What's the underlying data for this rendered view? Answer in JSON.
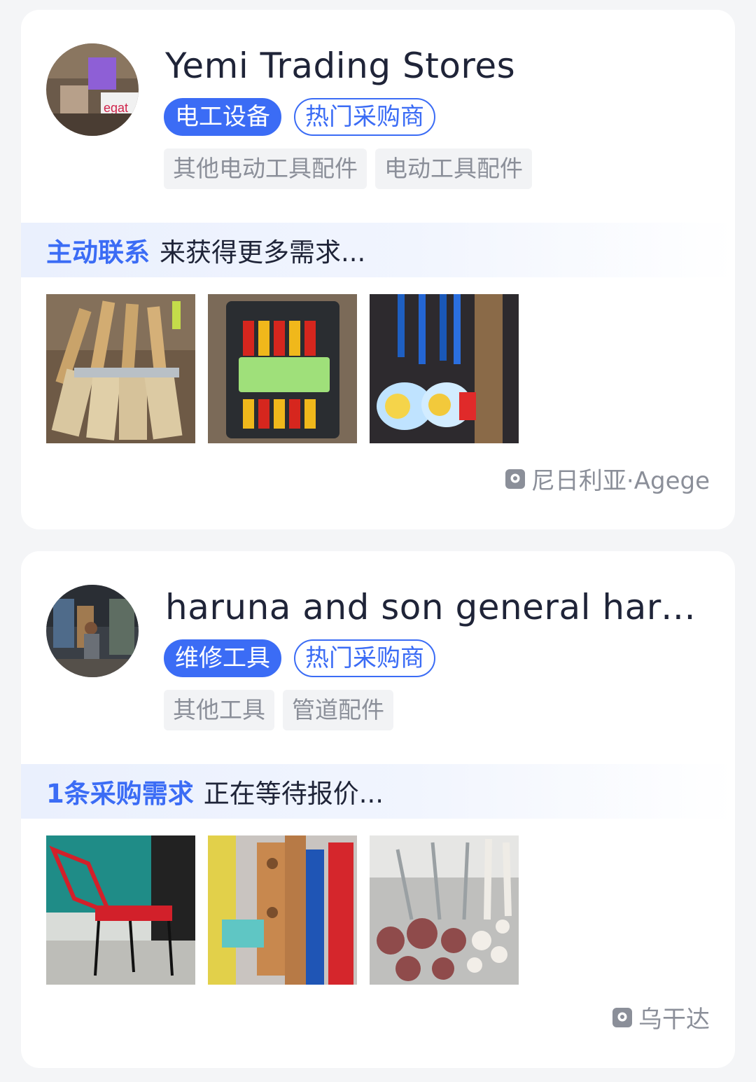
{
  "cards": [
    {
      "store_name": "Yemi Trading Stores",
      "primary_tag": "电工设备",
      "badge": "热门采购商",
      "categories": [
        "其他电动工具配件",
        "电动工具配件"
      ],
      "banner_highlight": "主动联系",
      "banner_text": "来获得更多需求...",
      "photo_names": [
        "paint-brushes-photo",
        "screwdriver-set-photo",
        "paint-rollers-photo"
      ],
      "location": "尼日利亚·Agege"
    },
    {
      "store_name": "haruna and son general hard...",
      "primary_tag": "维修工具",
      "badge": "热门采购商",
      "categories": [
        "其他工具",
        "管道配件"
      ],
      "banner_highlight": "1条采购需求",
      "banner_text": "正在等待报价...",
      "photo_names": [
        "red-chair-photo",
        "hardware-shelf-photo",
        "pipes-photo"
      ],
      "location": "乌干达"
    }
  ],
  "colors": {
    "accent": "#3b6cf5",
    "text_dark": "#1f2438",
    "text_muted": "#8b8f99",
    "page_bg": "#f4f5f7"
  },
  "icons": {
    "location": "location-pin-icon"
  }
}
